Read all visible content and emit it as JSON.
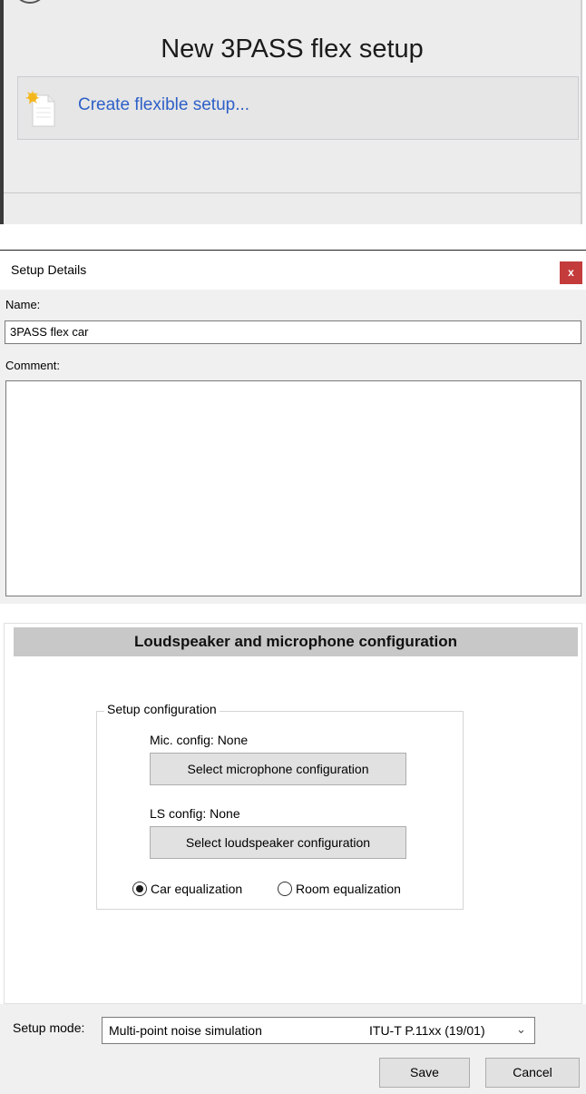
{
  "panel1": {
    "title": "New 3PASS flex setup",
    "create_link": "Create flexible setup...",
    "icon": "new-document-icon"
  },
  "dialog": {
    "title": "Setup Details",
    "close_glyph": "x",
    "name_label": "Name:",
    "name_value": "3PASS flex car",
    "comment_label": "Comment:",
    "comment_value": ""
  },
  "config": {
    "header": "Loudspeaker and microphone configuration",
    "group_label": "Setup configuration",
    "mic_label": "Mic. config: None",
    "mic_button": "Select microphone configuration",
    "ls_label": "LS config: None",
    "ls_button": "Select loudspeaker configuration",
    "radio_car": "Car equalization",
    "radio_room": "Room equalization",
    "selected_radio": "car"
  },
  "footer": {
    "mode_label": "Setup mode:",
    "mode_value": "Multi-point noise simulation",
    "mode_standard": "ITU-T P.11xx (19/01)",
    "save": "Save",
    "cancel": "Cancel"
  },
  "colors": {
    "link": "#2e60c8",
    "close_button": "#c43b3b",
    "header_bar": "#c8c8c8"
  }
}
